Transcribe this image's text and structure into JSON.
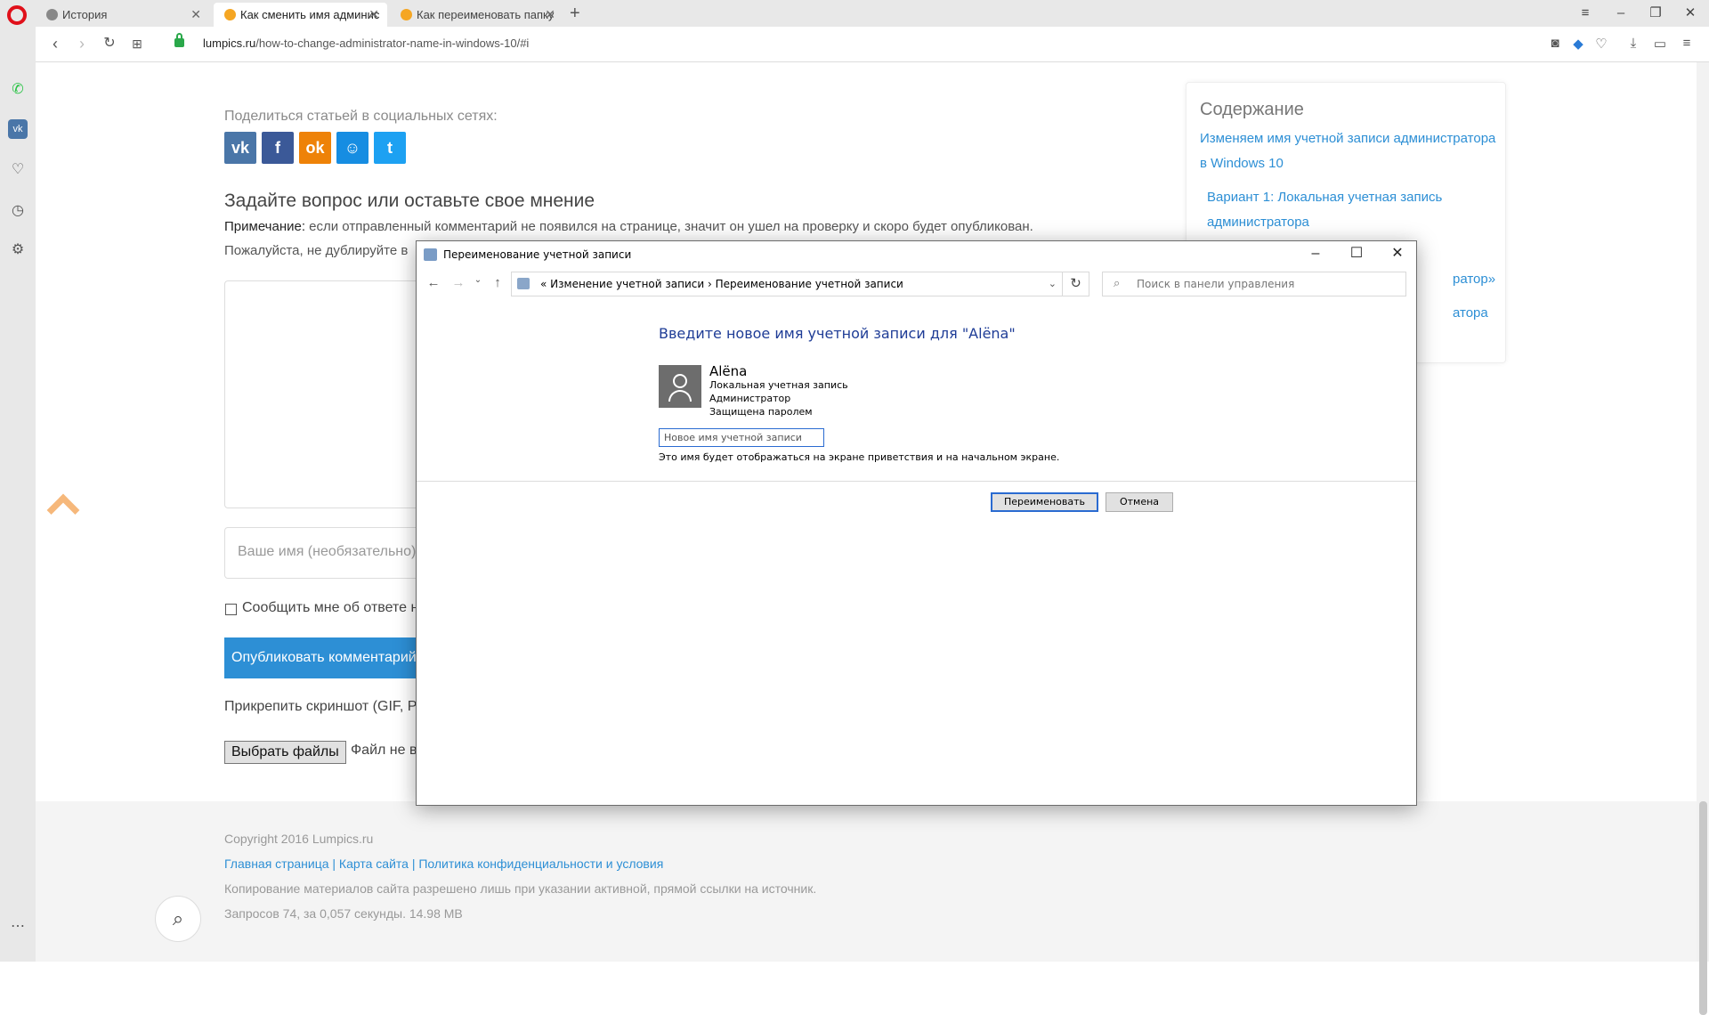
{
  "browser": {
    "tabs": [
      {
        "title": "История",
        "active": false
      },
      {
        "title": "Как сменить имя админис",
        "active": true
      },
      {
        "title": "Как переименовать папку",
        "active": false
      }
    ],
    "url_host": "lumpics.ru",
    "url_path": "/how-to-change-administrator-name-in-windows-10/#i"
  },
  "page": {
    "share_title": "Поделиться статьей в социальных сетях:",
    "social": [
      {
        "name": "vk",
        "glyph": "vk",
        "color": "#4a76a8"
      },
      {
        "name": "facebook",
        "glyph": "f",
        "color": "#3b5998"
      },
      {
        "name": "odnoklassniki",
        "glyph": "ok",
        "color": "#ee8208"
      },
      {
        "name": "mailru",
        "glyph": "☺",
        "color": "#168de2"
      },
      {
        "name": "twitter",
        "glyph": "t",
        "color": "#1da1f2"
      }
    ],
    "question_title": "Задайте вопрос или оставьте свое мнение",
    "note_label": "Примечание:",
    "note_text": " если отправленный комментарий не появился на странице, значит он ушел на проверку и скоро будет опубликован.",
    "note2": "Пожалуйста, не дублируйте в",
    "name_placeholder": "Ваше имя (необязательно)",
    "notify_label": "Сообщить мне об ответе н",
    "publish_label": "Опубликовать комментарий",
    "attach_label": "Прикрепить скриншот (GIF, P",
    "file_button": "Выбрать файлы",
    "file_label": "Файл не в"
  },
  "toc": {
    "title": "Содержание",
    "links": [
      "Изменяем имя учетной записи администратора",
      "в Windows 10",
      "Вариант 1: Локальная учетная запись",
      "администратора",
      "ратор»",
      "атора"
    ]
  },
  "footer": {
    "copyright": "Copyright 2016 Lumpics.ru",
    "links": "Главная страница | Карта сайта | Политика конфиденциальности и условия",
    "notice": "Копирование материалов сайта разрешено лишь при указании активной, прямой ссылки на источник.",
    "stats": "Запросов 74, за 0,057 секунды. 14.98 MB"
  },
  "dialog": {
    "title": "Переименование учетной записи",
    "breadcrumb_root": "Изменение учетной записи",
    "breadcrumb_current": "Переименование учетной записи",
    "search_placeholder": "Поиск в панели управления",
    "prompt": "Введите новое имя учетной записи для \"Alёna\"",
    "account_name": "Alёna",
    "account_type": "Локальная учетная запись",
    "account_role": "Администратор",
    "account_security": "Защищена паролем",
    "new_name_placeholder": "Новое имя учетной записи",
    "hint": "Это имя будет отображаться на экране приветствия и на начальном экране.",
    "rename_button": "Переименовать",
    "cancel_button": "Отмена"
  }
}
